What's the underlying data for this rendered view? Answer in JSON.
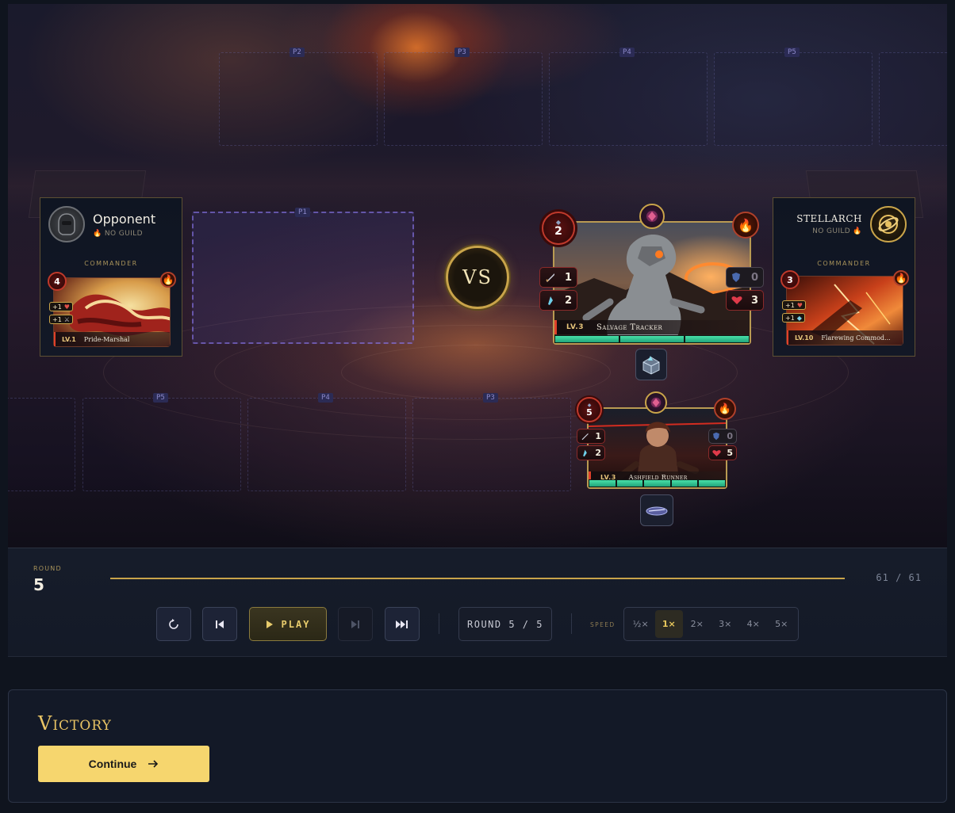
{
  "arena": {
    "top_slots": [
      "P2",
      "P3",
      "P4",
      "P5"
    ],
    "active_slot": "P1",
    "bottom_slots": [
      "P5",
      "P4",
      "P3"
    ],
    "vs_label": "VS"
  },
  "opponent": {
    "name": "Opponent",
    "guild": "NO GUILD",
    "role": "COMMANDER",
    "card": {
      "cost": "4",
      "buffs": [
        "+1",
        "+1"
      ],
      "level": "LV.1",
      "name": "Pride-Marshal"
    }
  },
  "player": {
    "name": "Stellarch",
    "guild": "NO GUILD",
    "role": "COMMANDER",
    "card": {
      "cost": "3",
      "buffs": [
        "+1",
        "+1"
      ],
      "level": "LV.10",
      "name": "Flarewing Commod..."
    }
  },
  "fighters": [
    {
      "id": "salvage",
      "cost": "2",
      "attack": "1",
      "power": "2",
      "shield": "0",
      "health": "3",
      "level": "LV.3",
      "name": "Salvage Tracker",
      "hp_segments": 3
    },
    {
      "id": "ashfield",
      "cost": "5",
      "attack": "1",
      "power": "2",
      "shield": "0",
      "health": "5",
      "level": "LV.3",
      "name": "Ashfield Runner",
      "hp_segments": 5
    }
  ],
  "controls": {
    "round_label": "ROUND",
    "round_value": "5",
    "progress": 1.0,
    "progress_text": "61 / 61",
    "play_label": "PLAY",
    "round_box": "ROUND 5 / 5",
    "speed_label": "SPEED",
    "speeds": [
      "½×",
      "1×",
      "2×",
      "3×",
      "4×",
      "5×"
    ],
    "active_speed": "1×"
  },
  "result": {
    "title": "Victory",
    "continue_label": "Continue"
  },
  "colors": {
    "accent_gold": "#c9a44a",
    "victory": "#e9c465",
    "button": "#f6d66e",
    "hp": "#2fc08c"
  }
}
